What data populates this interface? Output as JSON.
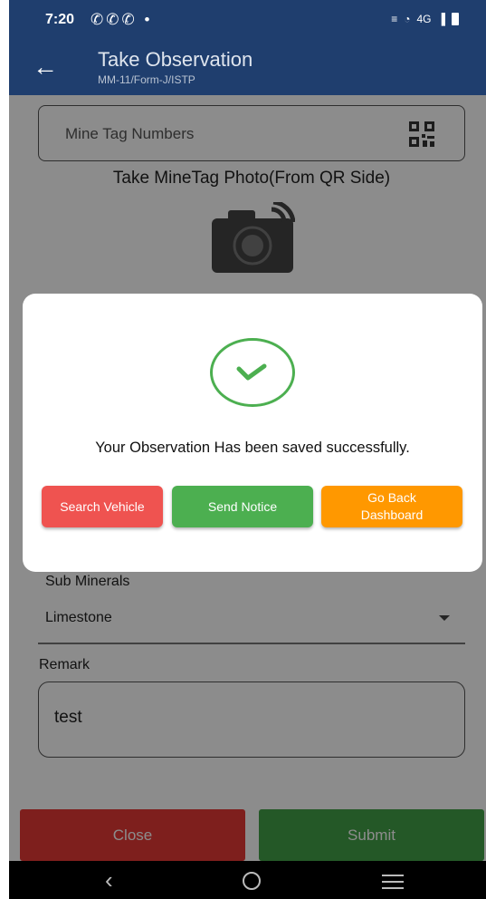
{
  "status_bar": {
    "time": "7:20",
    "left_icons": "✆✆✆ •",
    "signal_text": "4G"
  },
  "app_bar": {
    "title": "Take Observation",
    "subtitle": "MM-11/Form-J/ISTP",
    "back_icon": "arrow-left-icon"
  },
  "form": {
    "mine_tag_placeholder": "Mine Tag Numbers",
    "photo_label": "Take MineTag Photo(From QR Side)",
    "sub_minerals_label": "Sub Minerals",
    "sub_minerals_value": "Limestone",
    "remark_label": "Remark",
    "remark_value": "test"
  },
  "actions": {
    "close_label": "Close",
    "submit_label": "Submit"
  },
  "dialog": {
    "message": "Your Observation Has been saved successfully.",
    "search_vehicle_label": "Search Vehicle",
    "send_notice_label": "Send Notice",
    "go_back_line1": "Go Back",
    "go_back_line2": "Dashboard"
  },
  "colors": {
    "app_bar": "#1f3e6e",
    "success": "#4caf50",
    "search": "#ef5350",
    "back": "#ff9800"
  }
}
